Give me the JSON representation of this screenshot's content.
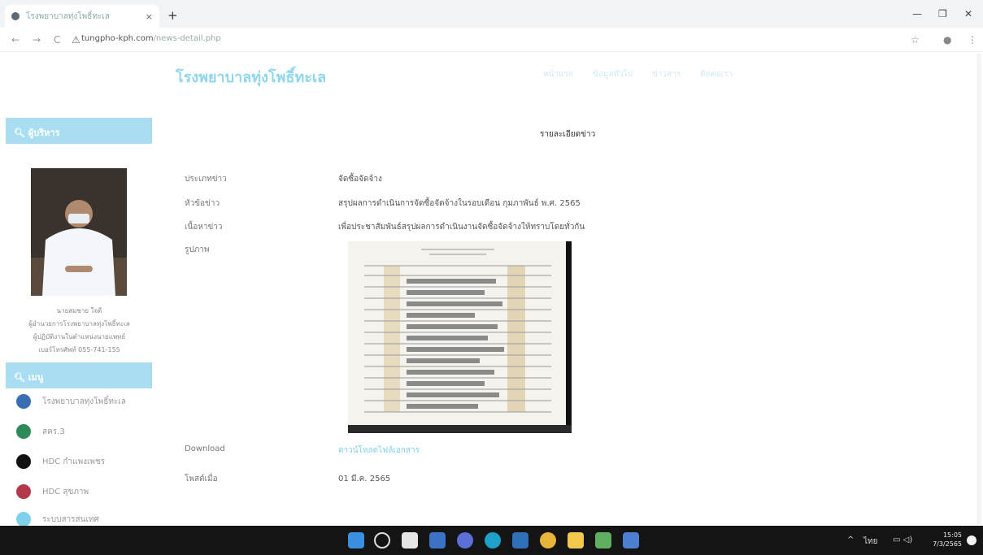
{
  "browser": {
    "tab_title": "โรงพยาบาลทุ่งโพธิ์ทะเล",
    "new_tab": "+",
    "tab_close": "×",
    "url_host": "tungpho-kph.com",
    "url_path": "/news-detail.php",
    "back": "←",
    "forward": "→",
    "reload": "C",
    "min": "—",
    "max": "❐",
    "close": "✕"
  },
  "site": {
    "name": "โรงพยาบาลทุ่งโพธิ์ทะเล",
    "nav": [
      "หน้าแรก",
      "ข้อมูลทั่วไป",
      "ข่าวสาร",
      "ติดต่อเรา"
    ]
  },
  "sidebar": {
    "director_heading": "ผู้บริหาร",
    "director_name": "นายสมชาย ใจดี",
    "director_lines": [
      "ผู้อำนวยการโรงพยาบาลทุ่งโพธิ์ทะเล",
      "ผู้ปฏิบัติงานในตำแหน่งนายแพทย์",
      "เบอร์โทรศัพท์ 055-741-155"
    ],
    "menu_heading": "เมนู",
    "menu_items": [
      {
        "label": "โรงพยาบาลทุ่งโพธิ์ทะเล",
        "icon": "hospital-icon",
        "color": "#3b6db3"
      },
      {
        "label": "สคร.3",
        "icon": "leaf-icon",
        "color": "#2e8b57"
      },
      {
        "label": "HDC กำแพงเพชร",
        "icon": "link-icon",
        "color": "#111111"
      },
      {
        "label": "HDC สุขภาพ",
        "icon": "globe-icon",
        "color": "#b3394a"
      },
      {
        "label": "ระบบสารสนเทศ",
        "icon": "info-icon",
        "color": "#7fd0ea"
      }
    ]
  },
  "content": {
    "title": "รายละเอียดข่าว",
    "rows": [
      {
        "label": "ประเภทข่าว",
        "value": "จัดซื้อจัดจ้าง"
      },
      {
        "label": "หัวข้อข่าว",
        "value": "สรุปผลการดำเนินการจัดซื้อจัดจ้างในรอบเดือน กุมภาพันธ์ พ.ศ. 2565"
      },
      {
        "label": "เนื้อหาข่าว",
        "value": "เพื่อประชาสัมพันธ์สรุปผลการดำเนินงานจัดซื้อจัดจ้างให้ทราบโดยทั่วกัน"
      },
      {
        "label": "รูปภาพ",
        "value": ""
      },
      {
        "label": "Download",
        "value": "ดาวน์โหลดไฟล์เอกสาร",
        "link": true
      },
      {
        "label": "โพสต์เมื่อ",
        "value": "01 มี.ค. 2565"
      }
    ]
  },
  "taskbar": {
    "tray_lang": "ไทย",
    "tray_arrow": "^",
    "time": "15:05",
    "date": "7/3/2565"
  }
}
